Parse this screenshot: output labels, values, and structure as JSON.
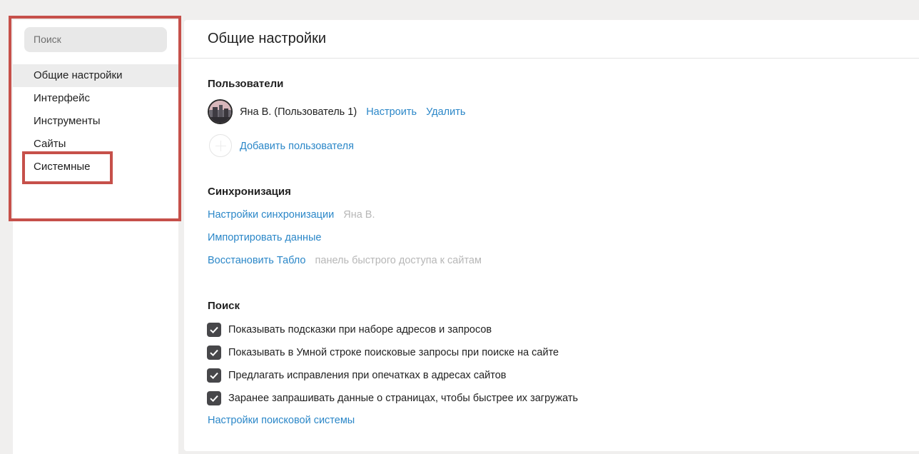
{
  "sidebar": {
    "search_placeholder": "Поиск",
    "items": [
      {
        "label": "Общие настройки",
        "active": true
      },
      {
        "label": "Интерфейс",
        "active": false
      },
      {
        "label": "Инструменты",
        "active": false
      },
      {
        "label": "Сайты",
        "active": false
      },
      {
        "label": "Системные",
        "active": false,
        "highlighted": true
      }
    ]
  },
  "main": {
    "title": "Общие настройки",
    "users": {
      "heading": "Пользователи",
      "current_user": "Яна В. (Пользователь 1)",
      "configure_link": "Настроить",
      "delete_link": "Удалить",
      "add_user_link": "Добавить пользователя"
    },
    "sync": {
      "heading": "Синхронизация",
      "settings_link": "Настройки синхронизации",
      "settings_hint": "Яна В.",
      "import_link": "Импортировать данные",
      "restore_link": "Восстановить Табло",
      "restore_hint": "панель быстрого доступа к сайтам"
    },
    "search": {
      "heading": "Поиск",
      "options": [
        {
          "label": "Показывать подсказки при наборе адресов и запросов",
          "checked": true
        },
        {
          "label": "Показывать в Умной строке поисковые запросы при поиске на сайте",
          "checked": true
        },
        {
          "label": "Предлагать исправления при опечатках в адресах сайтов",
          "checked": true
        },
        {
          "label": "Заранее запрашивать данные о страницах, чтобы быстрее их загружать",
          "checked": true
        }
      ],
      "engine_settings_link": "Настройки поисковой системы"
    }
  },
  "colors": {
    "link": "#2b87c8",
    "highlight": "#c6504a",
    "checkbox": "#47474a"
  }
}
